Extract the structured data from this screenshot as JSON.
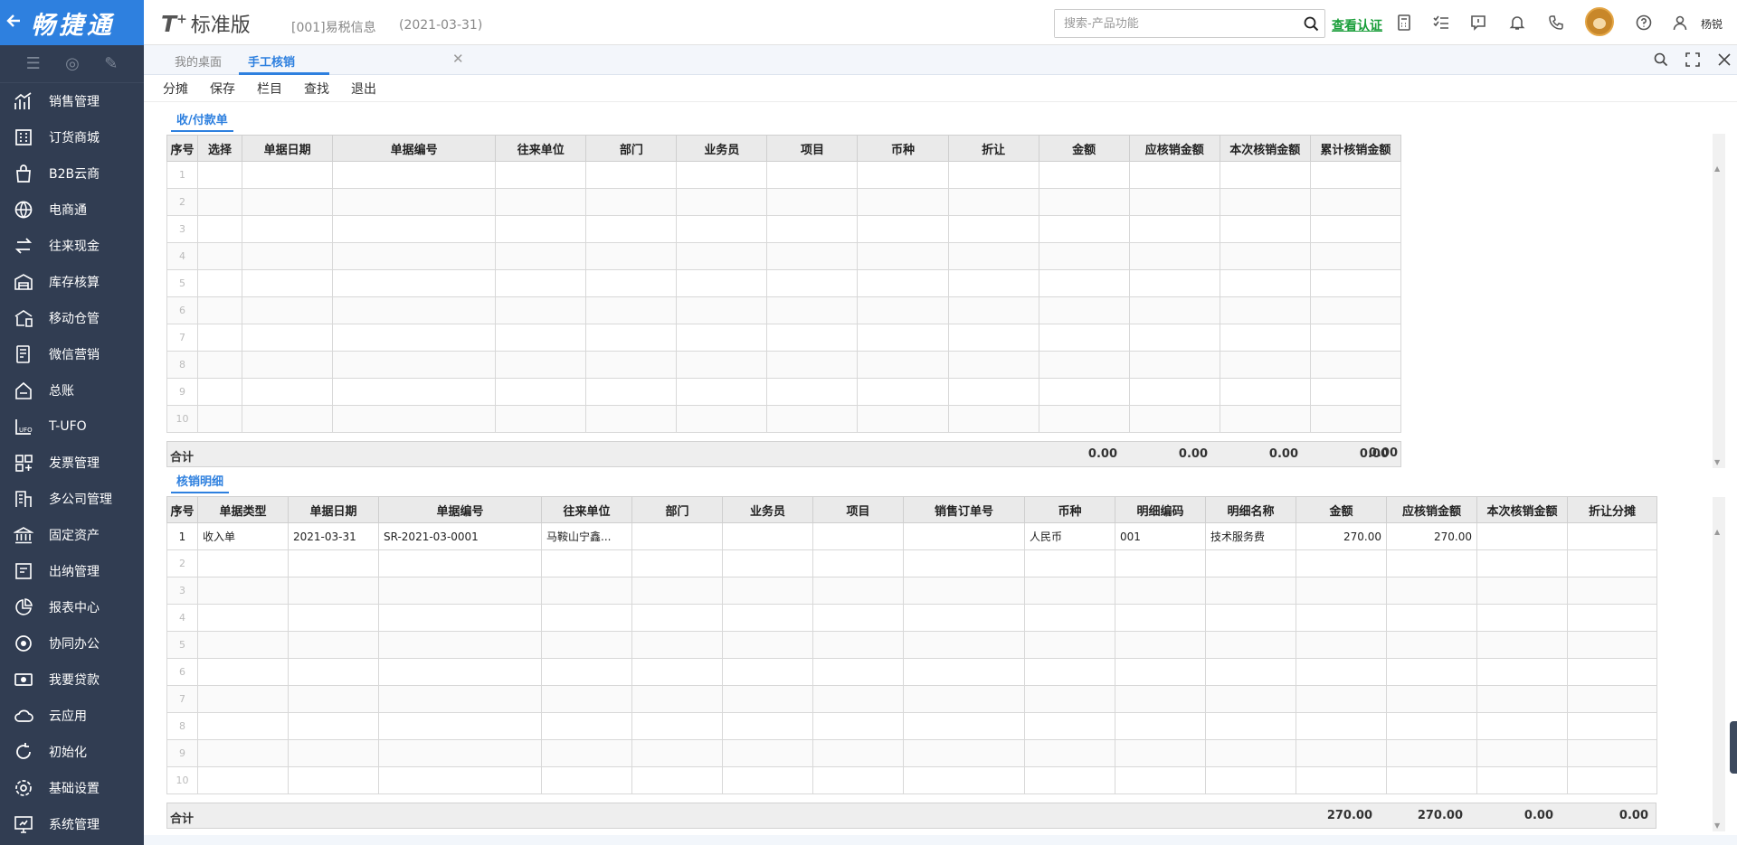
{
  "brand": {
    "name": "畅捷通"
  },
  "product": {
    "t": "T",
    "plus": "+",
    "edition": "标准版"
  },
  "account": {
    "name": "[001]易税信息",
    "date": "(2021-03-31)"
  },
  "search": {
    "placeholder": "搜索-产品功能"
  },
  "header": {
    "verify": "查看认证",
    "user": "杨锐"
  },
  "sidebar": {
    "items": [
      {
        "label": "销售管理",
        "icon": "chart-up-icon"
      },
      {
        "label": "订货商城",
        "icon": "store-icon"
      },
      {
        "label": "B2B云商",
        "icon": "bag-icon"
      },
      {
        "label": "电商通",
        "icon": "globe-icon"
      },
      {
        "label": "往来现金",
        "icon": "exchange-icon"
      },
      {
        "label": "库存核算",
        "icon": "warehouse-icon"
      },
      {
        "label": "移动仓管",
        "icon": "mobile-warehouse-icon"
      },
      {
        "label": "微信营销",
        "icon": "wechat-icon"
      },
      {
        "label": "总账",
        "icon": "ledger-icon"
      },
      {
        "label": "T-UFO",
        "icon": "ufo-icon"
      },
      {
        "label": "发票管理",
        "icon": "invoice-icon"
      },
      {
        "label": "多公司管理",
        "icon": "building-icon"
      },
      {
        "label": "固定资产",
        "icon": "bank-icon"
      },
      {
        "label": "出纳管理",
        "icon": "cashier-icon"
      },
      {
        "label": "报表中心",
        "icon": "pie-icon"
      },
      {
        "label": "协同办公",
        "icon": "collab-icon"
      },
      {
        "label": "我要贷款",
        "icon": "money-icon"
      },
      {
        "label": "云应用",
        "icon": "cloud-icon"
      },
      {
        "label": "初始化",
        "icon": "refresh-icon"
      },
      {
        "label": "基础设置",
        "icon": "settings-icon"
      },
      {
        "label": "系统管理",
        "icon": "system-icon"
      }
    ]
  },
  "tabs": [
    {
      "label": "我的桌面"
    },
    {
      "label": "手工核销"
    }
  ],
  "toolbar": {
    "items": [
      "分摊",
      "保存",
      "栏目",
      "查找",
      "退出"
    ]
  },
  "receipts": {
    "title": "收/付款单",
    "columns": [
      "序号",
      "选择",
      "单据日期",
      "单据编号",
      "往来单位",
      "部门",
      "业务员",
      "项目",
      "币种",
      "折让",
      "金额",
      "应核销金额",
      "本次核销金额",
      "累计核销金额"
    ],
    "rows": [
      1,
      2,
      3,
      4,
      5,
      6,
      7,
      8,
      9,
      10
    ],
    "total_label": "合计",
    "totals": [
      "0.00",
      "0.00",
      "0.00",
      "0.00",
      "0.00"
    ]
  },
  "details": {
    "title": "核销明细",
    "columns": [
      "序号",
      "单据类型",
      "单据日期",
      "单据编号",
      "往来单位",
      "部门",
      "业务员",
      "项目",
      "销售订单号",
      "币种",
      "明细编码",
      "明细名称",
      "金额",
      "应核销金额",
      "本次核销金额",
      "折让分摊"
    ],
    "row1": {
      "no": "1",
      "type": "收入单",
      "date": "2021-03-31",
      "code": "SR-2021-03-0001",
      "partner": "马鞍山宁鑫...",
      "currency": "人民币",
      "item_code": "001",
      "item_name": "技术服务费",
      "amount": "270.00",
      "due": "270.00"
    },
    "rows": [
      2,
      3,
      4,
      5,
      6,
      7,
      8,
      9,
      10
    ],
    "total_label": "合计",
    "totals": [
      "270.00",
      "270.00",
      "0.00",
      "0.00"
    ]
  }
}
